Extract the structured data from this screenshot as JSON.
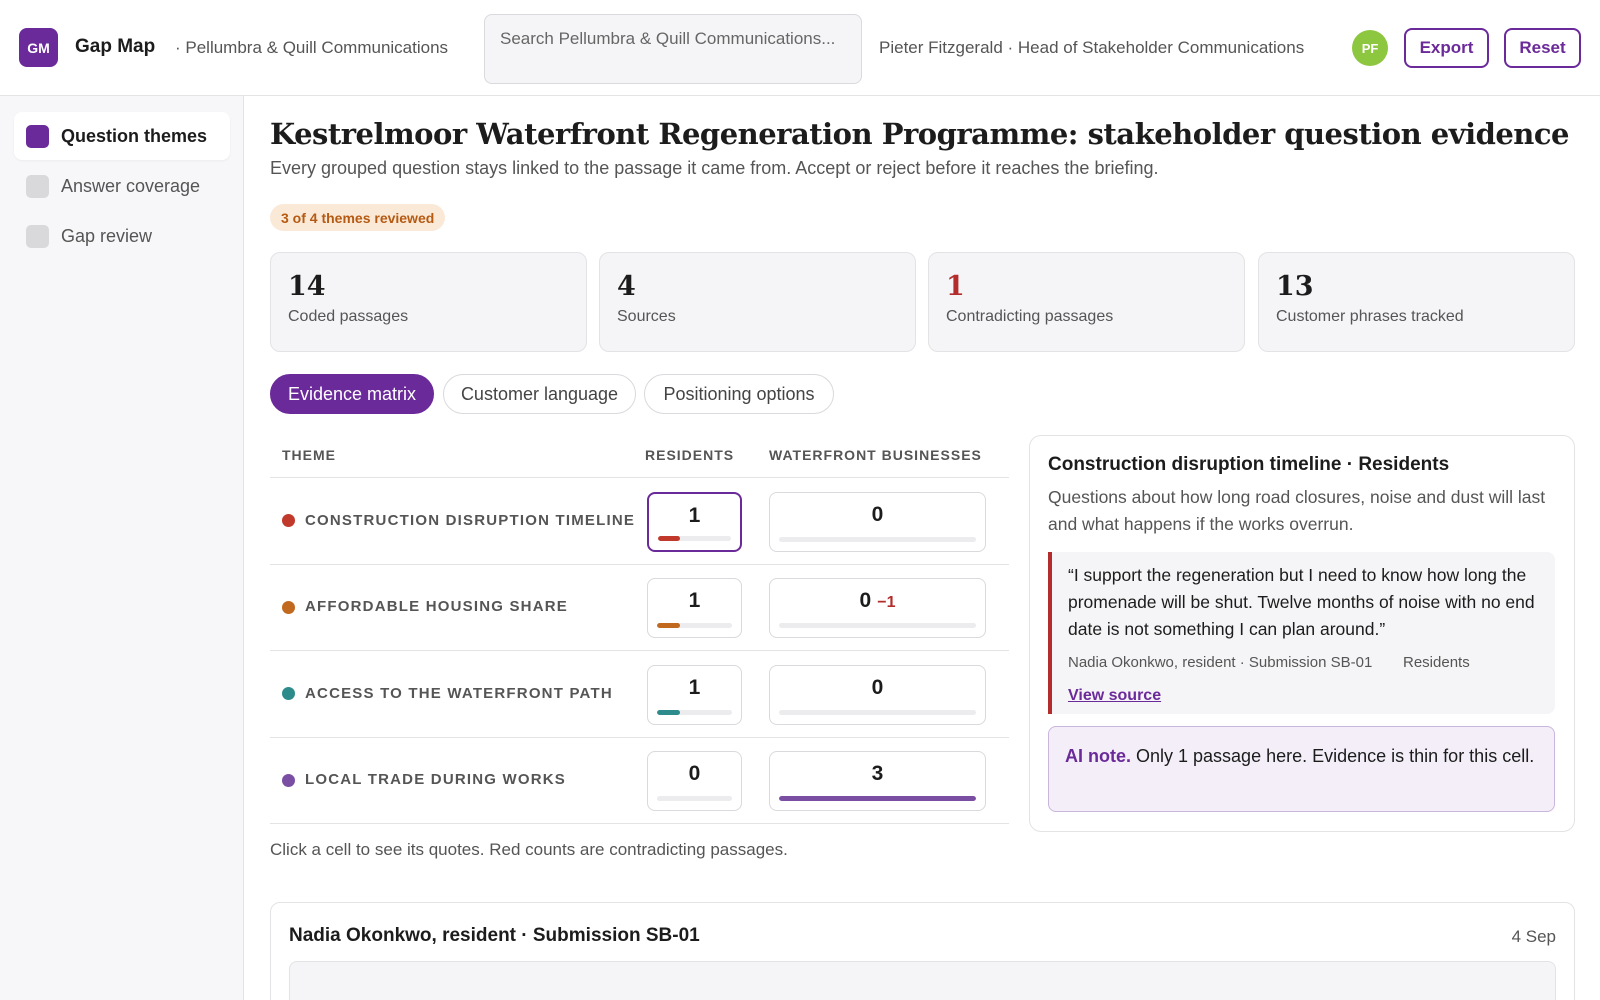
{
  "header": {
    "logo_text": "GM",
    "app_name": "Gap Map",
    "org": "· Pellumbra & Quill Communications",
    "search_placeholder": "Search Pellumbra & Quill Communications...",
    "user": "Pieter Fitzgerald · Head of Stakeholder Communications",
    "avatar_initials": "PF",
    "export_label": "Export",
    "reset_label": "Reset"
  },
  "sidebar": {
    "items": [
      {
        "label": "Question themes",
        "active": true
      },
      {
        "label": "Answer coverage",
        "active": false
      },
      {
        "label": "Gap review",
        "active": false
      }
    ]
  },
  "page": {
    "title": "Kestrelmoor Waterfront Regeneration Programme: stakeholder question evidence",
    "subtitle": "Every grouped question stays linked to the passage it came from. Accept or reject before it reaches the briefing.",
    "progress_badge": "3 of 4 themes reviewed"
  },
  "stats": [
    {
      "value": "14",
      "label": "Coded passages"
    },
    {
      "value": "4",
      "label": "Sources"
    },
    {
      "value": "1",
      "label": "Contradicting passages",
      "highlight": "red"
    },
    {
      "value": "13",
      "label": "Customer phrases tracked"
    }
  ],
  "tabs": [
    {
      "label": "Evidence matrix",
      "active": true
    },
    {
      "label": "Customer language",
      "active": false
    },
    {
      "label": "Positioning options",
      "active": false
    }
  ],
  "matrix": {
    "headers": {
      "theme": "THEME",
      "residents": "RESIDENTS",
      "businesses": "WATERFRONT BUSINESSES"
    },
    "rows": [
      {
        "theme": "CONSTRUCTION DISRUPTION TIMELINE",
        "color": "#c0392b",
        "residents": 1,
        "residents_fill": 0.3,
        "businesses": 0,
        "businesses_fill": 0,
        "businesses_contradicting": ""
      },
      {
        "theme": "AFFORDABLE HOUSING SHARE",
        "color": "#c0691f",
        "residents": 1,
        "residents_fill": 0.3,
        "businesses": 0,
        "businesses_fill": 0,
        "businesses_contradicting": "−1"
      },
      {
        "theme": "ACCESS TO THE WATERFRONT PATH",
        "color": "#2e8b8b",
        "residents": 1,
        "residents_fill": 0.3,
        "businesses": 0,
        "businesses_fill": 0,
        "businesses_contradicting": ""
      },
      {
        "theme": "LOCAL TRADE DURING WORKS",
        "color": "#7a4fa3",
        "residents": 0,
        "residents_fill": 0,
        "businesses": 3,
        "businesses_fill": 1.0,
        "businesses_contradicting": ""
      }
    ],
    "hint": "Click a cell to see its quotes. Red counts are contradicting passages."
  },
  "detail": {
    "title": "Construction disruption timeline · Residents",
    "description": "Questions about how long road closures, noise and dust will last and what happens if the works overrun.",
    "quote": "“I support the regeneration but I need to know how long the promenade will be shut. Twelve months of noise with no end date is not something I can plan around.”",
    "quote_source": "Nadia Okonkwo, resident · Submission SB-01",
    "quote_segment": "Residents",
    "view_source_label": "View source",
    "ai_note_prefix": "AI note.",
    "ai_note_text": " Only 1 passage here. Evidence is thin for this cell."
  },
  "source_card": {
    "title": "Nadia Okonkwo, resident · Submission SB-01",
    "date": "4 Sep"
  }
}
